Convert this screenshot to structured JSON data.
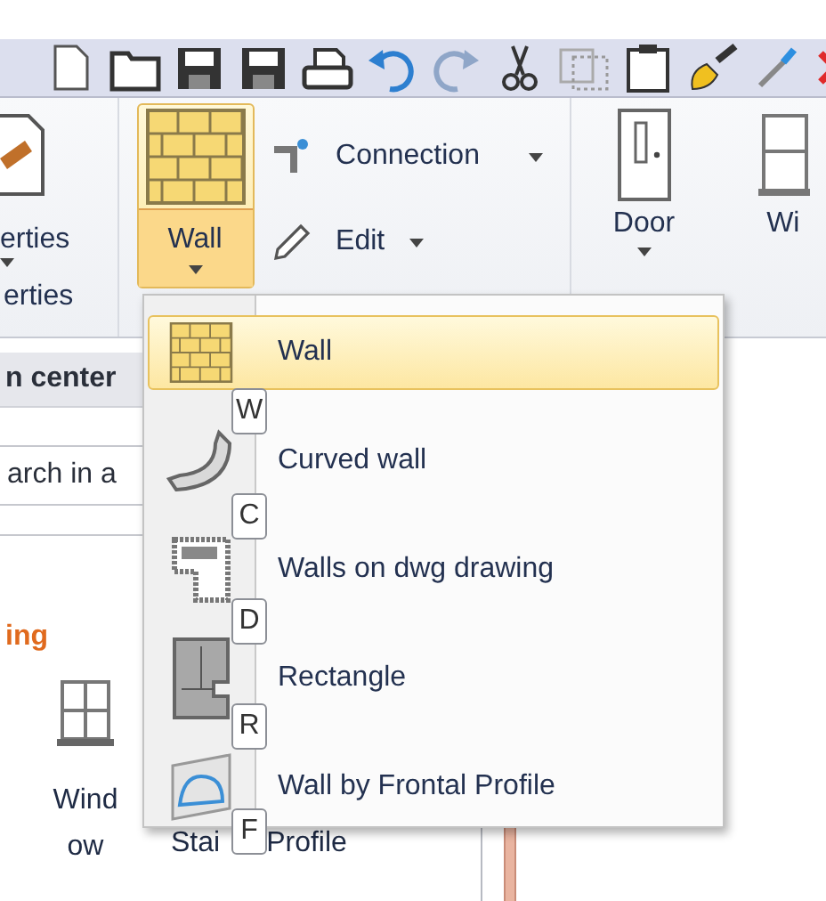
{
  "ribbon": {
    "properties": {
      "button": "erties",
      "group_label": "erties"
    },
    "wall_button": {
      "label": "Wall",
      "selected": true
    },
    "small_buttons": [
      {
        "label": "Connection",
        "kind": "connection"
      },
      {
        "label": "Edit",
        "kind": "edit"
      }
    ],
    "large_buttons": [
      {
        "label": "Door",
        "kind": "door",
        "dropdown": true
      },
      {
        "label": "Wi",
        "kind": "window",
        "dropdown": false
      }
    ]
  },
  "panel": {
    "title": "n center",
    "search": {
      "placeholder": "arch in a"
    },
    "section": "ing",
    "items": [
      {
        "lines": [
          "Wind",
          "ow"
        ]
      }
    ],
    "texts": [
      "Stai",
      "Profile"
    ]
  },
  "menu": {
    "items": [
      {
        "label": "Wall",
        "keytip": "W",
        "kind": "wall",
        "selected": true
      },
      {
        "label": "Curved wall",
        "keytip": "C",
        "kind": "curved",
        "selected": false
      },
      {
        "label": "Walls on dwg drawing",
        "keytip": "D",
        "kind": "dwg",
        "selected": false
      },
      {
        "label": "Rectangle",
        "keytip": "R",
        "kind": "rectangle",
        "selected": false
      },
      {
        "label": "Wall by Frontal Profile",
        "keytip": "F",
        "kind": "frontal",
        "selected": false
      }
    ]
  }
}
